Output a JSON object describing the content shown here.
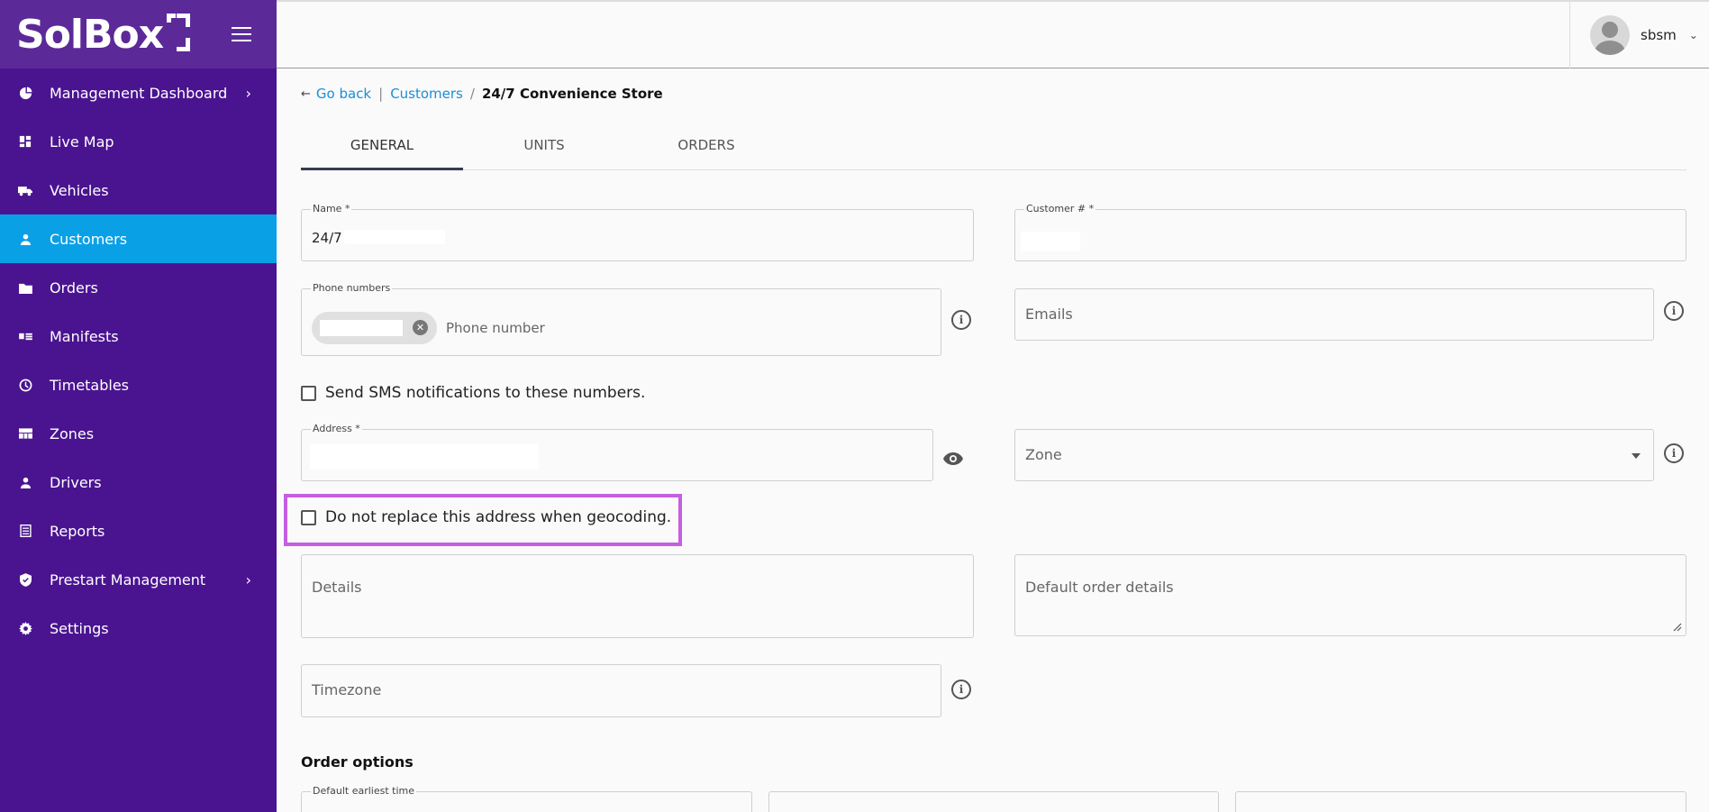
{
  "app": {
    "logo_text": "SolBox"
  },
  "sidebar": {
    "items": [
      {
        "label": "Management Dashboard",
        "icon": "pie-chart-icon",
        "chevron": true
      },
      {
        "label": "Live Map",
        "icon": "dashboard-icon",
        "chevron": false
      },
      {
        "label": "Vehicles",
        "icon": "truck-icon",
        "chevron": false
      },
      {
        "label": "Customers",
        "icon": "person-icon",
        "chevron": false,
        "active": true
      },
      {
        "label": "Orders",
        "icon": "folder-icon",
        "chevron": false
      },
      {
        "label": "Manifests",
        "icon": "list-card-icon",
        "chevron": false
      },
      {
        "label": "Timetables",
        "icon": "clock-icon",
        "chevron": false
      },
      {
        "label": "Zones",
        "icon": "grid-icon",
        "chevron": false
      },
      {
        "label": "Drivers",
        "icon": "person-icon",
        "chevron": false
      },
      {
        "label": "Reports",
        "icon": "report-icon",
        "chevron": false
      },
      {
        "label": "Prestart Management",
        "icon": "shield-icon",
        "chevron": true
      },
      {
        "label": "Settings",
        "icon": "gear-icon",
        "chevron": false
      }
    ],
    "chevron_glyph": "›",
    "active_color": "#0aa0e6",
    "bg_color": "#4a1490"
  },
  "topbar": {
    "username": "sbsm",
    "chevron": "⌄"
  },
  "breadcrumb": {
    "back_arrow": "←",
    "back_label": "Go back",
    "divider": "|",
    "parent": "Customers",
    "slash": "/",
    "current": "24/7 Convenience Store"
  },
  "tabs": [
    {
      "label": "GENERAL",
      "active": true
    },
    {
      "label": "UNITS",
      "active": false
    },
    {
      "label": "ORDERS",
      "active": false
    }
  ],
  "form": {
    "name_label": "Name *",
    "name_value": "24/7",
    "customer_label": "Customer # *",
    "phone_label": "Phone numbers",
    "phone_placeholder": "Phone number",
    "emails_placeholder": "Emails",
    "sms_label": "Send SMS notifications to these numbers.",
    "address_label": "Address *",
    "zone_placeholder": "Zone",
    "geocode_label": "Do not replace this address when geocoding.",
    "details_placeholder": "Details",
    "default_details_placeholder": "Default order details",
    "timezone_placeholder": "Timezone",
    "info_glyph": "i",
    "chip_close_glyph": "✕"
  },
  "order_options": {
    "title": "Order options",
    "earliest_label": "Default earliest time"
  },
  "colors": {
    "highlight": "#c55ee0",
    "link": "#1a8fd6"
  }
}
